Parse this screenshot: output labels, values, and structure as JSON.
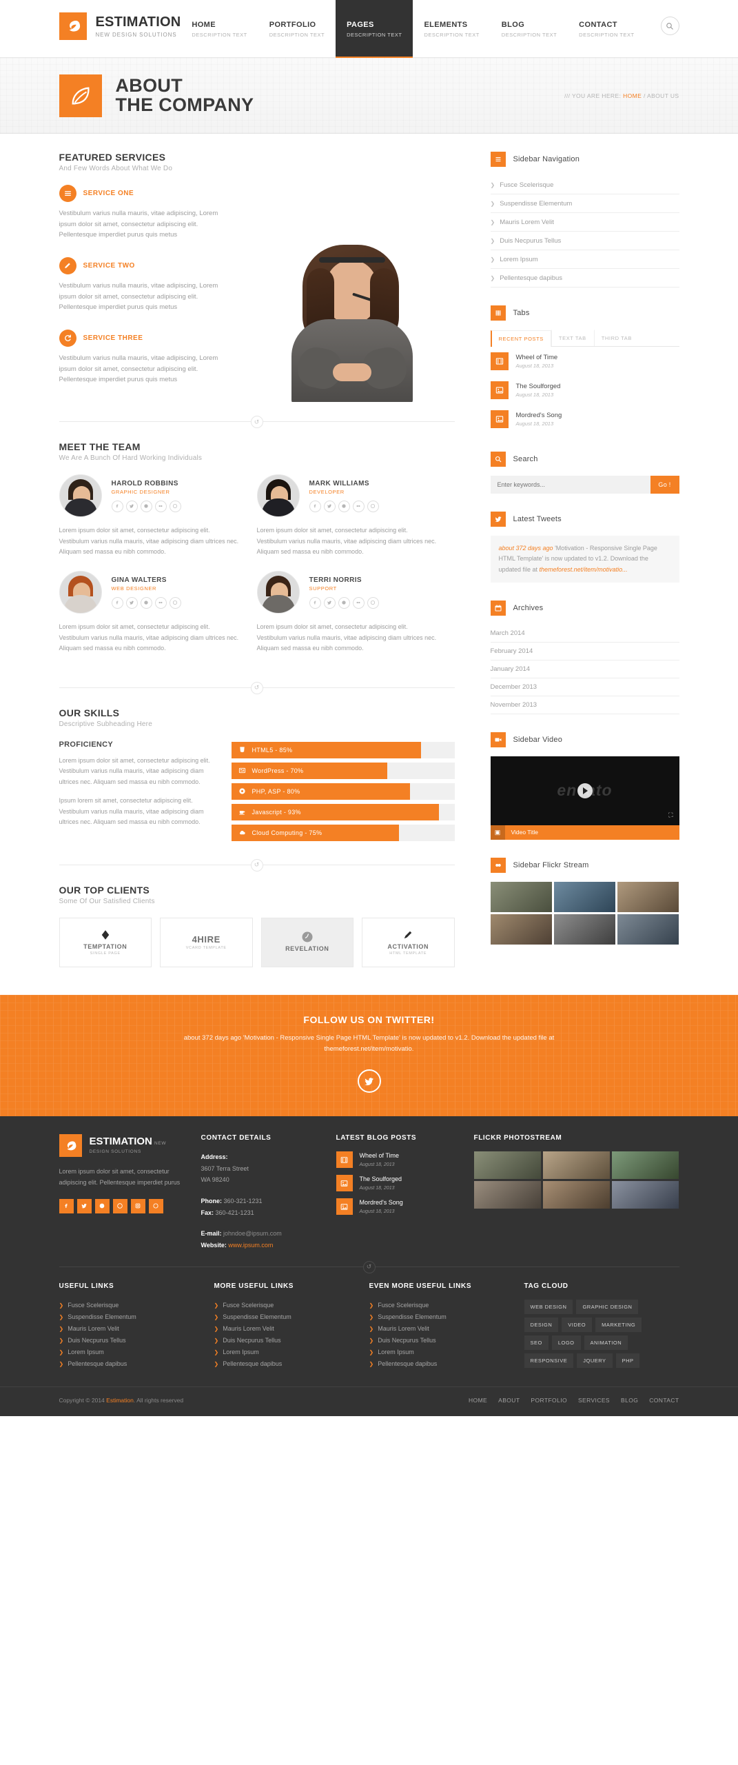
{
  "header": {
    "brand_name": "ESTIMATION",
    "brand_tagline": "NEW DESIGN SOLUTIONS",
    "nav": [
      {
        "label": "HOME",
        "desc": "DESCRIPTION TEXT",
        "active": false
      },
      {
        "label": "PORTFOLIO",
        "desc": "DESCRIPTION TEXT",
        "active": false
      },
      {
        "label": "PAGES",
        "desc": "DESCRIPTION TEXT",
        "active": true
      },
      {
        "label": "ELEMENTS",
        "desc": "DESCRIPTION TEXT",
        "active": false
      },
      {
        "label": "BLOG",
        "desc": "DESCRIPTION TEXT",
        "active": false
      },
      {
        "label": "CONTACT",
        "desc": "DESCRIPTION TEXT",
        "active": false
      }
    ],
    "search_icon": "search-icon"
  },
  "banner": {
    "title_line1": "ABOUT",
    "title_line2": "THE COMPANY",
    "breadcrumb_prefix": "/// YOU ARE HERE:",
    "breadcrumb_home": "HOME",
    "breadcrumb_sep": "/",
    "breadcrumb_current": "ABOUT US",
    "icon": "leaf-icon"
  },
  "featured": {
    "heading": "FEATURED SERVICES",
    "subheading": "And Few Words About What We Do",
    "services": [
      {
        "icon": "list-icon",
        "title": "SERVICE ONE",
        "body": "Vestibulum varius nulla mauris, vitae adipiscing, Lorem ipsum dolor sit amet, consectetur adipiscing elit. Pellentesque imperdiet purus quis metus"
      },
      {
        "icon": "pencil-icon",
        "title": "SERVICE TWO",
        "body": "Vestibulum varius nulla mauris, vitae adipiscing, Lorem ipsum dolor sit amet, consectetur adipiscing elit. Pellentesque imperdiet purus quis metus"
      },
      {
        "icon": "refresh-icon",
        "title": "SERVICE THREE",
        "body": "Vestibulum varius nulla mauris, vitae adipiscing, Lorem ipsum dolor sit amet, consectetur adipiscing elit. Pellentesque imperdiet purus quis metus"
      }
    ],
    "photo_alt": "call-center-agent-photo"
  },
  "team": {
    "heading": "MEET THE TEAM",
    "subheading": "We Are A Bunch Of Hard Working Individuals",
    "social_icons": [
      "facebook-icon",
      "twitter-icon",
      "skype-icon",
      "flickr-icon",
      "dribbble-icon"
    ],
    "members": [
      {
        "name": "HAROLD ROBBINS",
        "role": "GRAPHIC DESIGNER",
        "desc": "Lorem ipsum dolor sit amet, consectetur adipiscing elit. Vestibulum varius nulla mauris, vitae adipiscing diam ultrices nec. Aliquam sed massa eu nibh commodo.",
        "hair": "#2f2218",
        "shirt": "#2b2b30"
      },
      {
        "name": "MARK WILLIAMS",
        "role": "DEVELOPER",
        "desc": "Lorem ipsum dolor sit amet, consectetur adipiscing elit. Vestibulum varius nulla mauris, vitae adipiscing diam ultrices nec. Aliquam sed massa eu nibh commodo.",
        "hair": "#1c1510",
        "shirt": "#1f1f24"
      },
      {
        "name": "GINA WALTERS",
        "role": "WEB DESIGNER",
        "desc": "Lorem ipsum dolor sit amet, consectetur adipiscing elit. Vestibulum varius nulla mauris, vitae adipiscing diam ultrices nec. Aliquam sed massa eu nibh commodo.",
        "hair": "#b4511f",
        "shirt": "#d8d2cc"
      },
      {
        "name": "TERRI NORRIS",
        "role": "SUPPORT",
        "desc": "Lorem ipsum dolor sit amet, consectetur adipiscing elit. Vestibulum varius nulla mauris, vitae adipiscing diam ultrices nec. Aliquam sed massa eu nibh commodo.",
        "hair": "#3a2417",
        "shirt": "#6d6a66"
      }
    ]
  },
  "skills": {
    "heading": "OUR SKILLS",
    "subheading": "Descriptive Subheading Here",
    "proficiency_title": "PROFICIENCY",
    "paragraphs": [
      "Lorem ipsum dolor sit amet, consectetur adipiscing elit. Vestibulum varius nulla mauris, vitae adipiscing diam ultrices nec. Aliquam sed massa eu nibh commodo.",
      "Ipsum lorem sit amet, consectetur adipiscing elit. Vestibulum varius nulla mauris, vitae adipiscing diam ultrices nec. Aliquam sed massa eu nibh commodo."
    ],
    "bars": [
      {
        "icon": "html5-icon",
        "label": "HTML5 - 85%",
        "value": 85
      },
      {
        "icon": "wordpress-icon",
        "label": "WordPress - 70%",
        "value": 70
      },
      {
        "icon": "gear-icon",
        "label": "PHP, ASP - 80%",
        "value": 80
      },
      {
        "icon": "coffee-icon",
        "label": "Javascript - 93%",
        "value": 93
      },
      {
        "icon": "cloud-icon",
        "label": "Cloud Computing - 75%",
        "value": 75
      }
    ]
  },
  "clients": {
    "heading": "OUR TOP CLIENTS",
    "subheading": "Some Of Our Satisfied Clients",
    "items": [
      {
        "name": "TEMPTATION",
        "sub": "SINGLE PAGE",
        "mark": "diamond-mark"
      },
      {
        "name": "4HIRE",
        "sub": "VCARD TEMPLATE",
        "mark": "text-mark"
      },
      {
        "name": "REVELATION",
        "sub": "",
        "mark": "circle-mark"
      },
      {
        "name": "ACTIVATION",
        "sub": "HTML TEMPLATE",
        "mark": "pen-mark"
      }
    ]
  },
  "sidebar": {
    "navigation": {
      "title": "Sidebar Navigation",
      "icon": "list-icon",
      "items": [
        "Fusce Scelerisque",
        "Suspendisse Elementum",
        "Mauris Lorem Velit",
        "Duis Necpurus Tellus",
        "Lorem Ipsum",
        "Pellentesque dapibus"
      ]
    },
    "tabs": {
      "title": "Tabs",
      "icon": "grid-icon",
      "tabs": [
        {
          "label": "RECENT POSTS",
          "active": true
        },
        {
          "label": "TEXT TAB",
          "active": false
        },
        {
          "label": "THIRD TAB",
          "active": false
        }
      ],
      "posts": [
        {
          "title": "Wheel of Time",
          "date": "August 18, 2013",
          "icon": "film-icon"
        },
        {
          "title": "The Soulforged",
          "date": "August 18, 2013",
          "icon": "image-icon"
        },
        {
          "title": "Mordred's Song",
          "date": "August 18, 2013",
          "icon": "image-icon"
        }
      ]
    },
    "search": {
      "title": "Search",
      "icon": "search-icon",
      "placeholder": "Enter keywords...",
      "value": "",
      "button": "Go !"
    },
    "tweets": {
      "title": "Latest Tweets",
      "icon": "twitter-icon",
      "ago": "about 372 days ago",
      "text": " 'Motivation - Responsive Single Page HTML Template' is now updated to v1.2. Download the updated file at ",
      "link": "themeforest.net/item/motivatio..."
    },
    "archives": {
      "title": "Archives",
      "icon": "calendar-icon",
      "items": [
        "March 2014",
        "February 2014",
        "January 2014",
        "December 2013",
        "November 2013"
      ]
    },
    "video": {
      "title": "Sidebar Video",
      "icon": "video-icon",
      "logo_text": "envato",
      "caption": "Video Title",
      "play_icon": "play-icon",
      "fullscreen_icon": "fullscreen-icon"
    },
    "flickr": {
      "title": "Sidebar Flickr Stream",
      "icon": "flickr-icon",
      "photos": [
        "photo-1",
        "photo-2",
        "photo-3",
        "photo-4",
        "photo-5",
        "photo-6"
      ]
    }
  },
  "cta": {
    "heading": "FOLLOW US ON TWITTER!",
    "text": "about 372 days ago 'Motivation - Responsive Single Page HTML Template' is now updated to v1.2. Download the updated file at themeforest.net/item/motivatio.",
    "icon": "twitter-icon"
  },
  "footer": {
    "brand_name": "ESTIMATION",
    "brand_tagline": "NEW DESIGN SOLUTIONS",
    "about_text": "Lorem ipsum dolor sit amet, consectetur adipiscing elit. Pellentesque imperdiet purus",
    "socials": [
      "facebook-icon",
      "twitter-icon",
      "skype-icon",
      "dribbble-icon",
      "instagram-icon",
      "google-plus-icon"
    ],
    "contact": {
      "heading": "CONTACT DETAILS",
      "address_label": "Address:",
      "address_line1": "3607 Terra Street",
      "address_line2": "WA 98240",
      "phone_label": "Phone:",
      "phone_value": "360-321-1231",
      "fax_label": "Fax:",
      "fax_value": "360-421-1231",
      "email_label": "E-mail:",
      "email_value": "johndoe@ipsum.com",
      "website_label": "Website:",
      "website_value": "www.ipsum.com"
    },
    "blog": {
      "heading": "LATEST BLOG POSTS",
      "posts": [
        {
          "title": "Wheel of Time",
          "date": "August 18, 2013",
          "icon": "film-icon"
        },
        {
          "title": "The Soulforged",
          "date": "August 18, 2013",
          "icon": "image-icon"
        },
        {
          "title": "Mordred's Song",
          "date": "August 18, 2013",
          "icon": "image-icon"
        }
      ]
    },
    "photostream": {
      "heading": "FLICKR PHOTOSTREAM",
      "photos": [
        "photo-1",
        "photo-2",
        "photo-3",
        "photo-4",
        "photo-5",
        "photo-6"
      ]
    },
    "link_columns": [
      {
        "heading": "USEFUL LINKS",
        "links": [
          "Fusce Scelerisque",
          "Suspendisse Elementum",
          "Mauris Lorem Velit",
          "Duis Necpurus Tellus",
          "Lorem Ipsum",
          "Pellentesque dapibus"
        ]
      },
      {
        "heading": "MORE USEFUL LINKS",
        "links": [
          "Fusce Scelerisque",
          "Suspendisse Elementum",
          "Mauris Lorem Velit",
          "Duis Necpurus Tellus",
          "Lorem Ipsum",
          "Pellentesque dapibus"
        ]
      },
      {
        "heading": "EVEN MORE USEFUL LINKS",
        "links": [
          "Fusce Scelerisque",
          "Suspendisse Elementum",
          "Mauris Lorem Velit",
          "Duis Necpurus Tellus",
          "Lorem Ipsum",
          "Pellentesque dapibus"
        ]
      }
    ],
    "tag_cloud": {
      "heading": "TAG CLOUD",
      "tags": [
        "WEB DESIGN",
        "GRAPHIC DESIGN",
        "DESIGN",
        "VIDEO",
        "MARKETING",
        "SEO",
        "LOGO",
        "ANIMATION",
        "RESPONSIVE",
        "JQUERY",
        "PHP"
      ]
    },
    "copyright_prefix": "Copyright © 2014",
    "copyright_brand": "Estimation",
    "copyright_suffix": ". All rights reserved",
    "bottom_nav": [
      "HOME",
      "ABOUT",
      "PORTFOLIO",
      "SERVICES",
      "BLOG",
      "CONTACT"
    ]
  },
  "colors": {
    "accent": "#f48024",
    "dark": "#333333",
    "text": "#9c9c9c"
  }
}
